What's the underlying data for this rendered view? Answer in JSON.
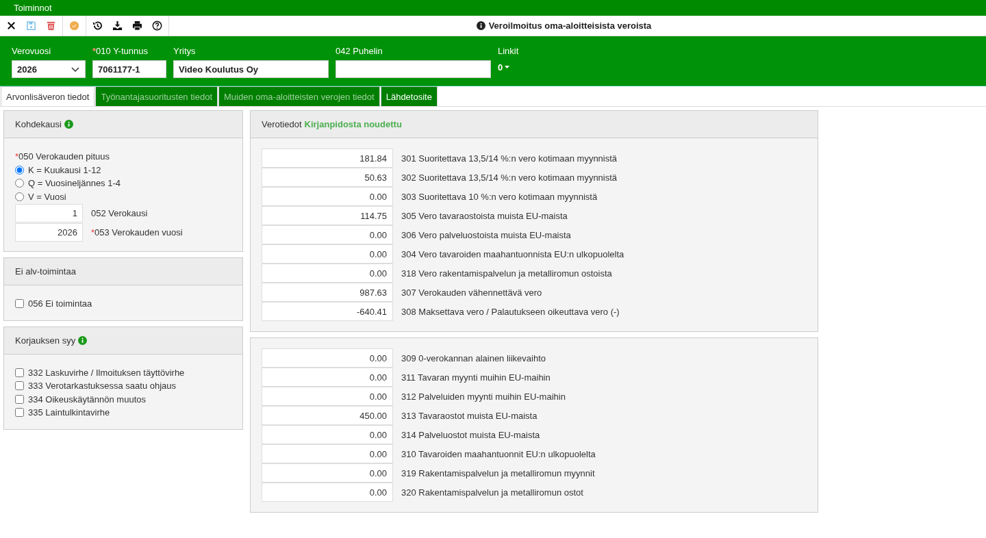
{
  "menu_bar": {
    "title": "Toiminnot"
  },
  "toolbar": {
    "title": "Veroilmoitus oma-aloitteisista veroista"
  },
  "header_fields": [
    {
      "kind": "select",
      "label": "Verovuosi",
      "value": "2026"
    },
    {
      "kind": "input",
      "label": "010 Y-tunnus",
      "required_mark": "*",
      "value": "7061177-1"
    },
    {
      "kind": "input",
      "label": "Yritys",
      "value": "Video Koulutus Oy",
      "wide": true
    },
    {
      "kind": "input",
      "label": "042 Puhelin",
      "wide": true
    },
    {
      "kind": "links",
      "label": "Linkit",
      "value": "0"
    }
  ],
  "tabs": [
    {
      "label": "Arvonlisäveron tiedot",
      "selected": true
    },
    {
      "label": "Työnantajasuoritusten tiedot",
      "selected": false
    },
    {
      "label": "Muiden oma-aloitteisten verojen tiedot",
      "selected": false
    },
    {
      "label": "Lähdetosite",
      "selected": false
    }
  ],
  "left_panels": [
    {
      "title": "Kohdekausi",
      "info": true,
      "items": [
        {
          "kind": "label",
          "text": "050 Verokauden pituus",
          "required_mark": "*"
        },
        {
          "kind": "radio",
          "text": "K = Kuukausi 1-12",
          "selected": true
        },
        {
          "kind": "radio",
          "text": "Q = Vuosineljännes 1-4",
          "selected": false
        },
        {
          "kind": "radio",
          "text": "V = Vuosi",
          "selected": false
        },
        {
          "kind": "field",
          "value": "1",
          "text": "052 Verokausi"
        },
        {
          "kind": "field",
          "value": "2026",
          "text": "053 Verokauden vuosi",
          "required_mark": "*"
        }
      ]
    },
    {
      "title": "Ei alv-toimintaa",
      "info": false,
      "items": [
        {
          "kind": "checkbox",
          "text": "056 Ei toimintaa",
          "checked": false
        }
      ]
    },
    {
      "title": "Korjauksen syy",
      "info": true,
      "items": [
        {
          "kind": "checkbox",
          "text": "332 Laskuvirhe / Ilmoituksen täyttövirhe",
          "checked": false
        },
        {
          "kind": "checkbox",
          "text": "333 Verotarkastuksessa saatu ohjaus",
          "checked": false
        },
        {
          "kind": "checkbox",
          "text": "334 Oikeuskäytännön muutos",
          "checked": false
        },
        {
          "kind": "checkbox",
          "text": "335 Laintulkintavirhe",
          "checked": false
        }
      ]
    }
  ],
  "tax_panels": [
    {
      "title": "Verotiedot",
      "status": "Kirjanpidosta noudettu",
      "rows": [
        {
          "value": "181.84",
          "label": "301 Suoritettava 13,5/14 %:n vero kotimaan myynnistä"
        },
        {
          "value": "50.63",
          "label": "302 Suoritettava 13,5/14 %:n vero kotimaan myynnistä"
        },
        {
          "value": "0.00",
          "label": "303 Suoritettava 10 %:n vero kotimaan myynnistä"
        },
        {
          "value": "114.75",
          "label": "305 Vero tavaraostoista muista EU-maista"
        },
        {
          "value": "0.00",
          "label": "306 Vero palveluostoista muista EU-maista"
        },
        {
          "value": "0.00",
          "label": "304 Vero tavaroiden maahantuonnista EU:n ulkopuolelta"
        },
        {
          "value": "0.00",
          "label": "318 Vero rakentamispalvelun ja metalliromun ostoista"
        },
        {
          "value": "987.63",
          "label": "307 Verokauden vähennettävä vero"
        },
        {
          "value": "-640.41",
          "label": "308 Maksettava vero / Palautukseen oikeuttava vero (-)"
        }
      ]
    },
    {
      "rows": [
        {
          "value": "0.00",
          "label": "309 0-verokannan alainen liikevaihto"
        },
        {
          "value": "0.00",
          "label": "311 Tavaran myynti muihin EU-maihin"
        },
        {
          "value": "0.00",
          "label": "312 Palveluiden myynti muihin EU-maihin"
        },
        {
          "value": "450.00",
          "label": "313 Tavaraostot muista EU-maista"
        },
        {
          "value": "0.00",
          "label": "314 Palveluostot muista EU-maista"
        },
        {
          "value": "0.00",
          "label": "310 Tavaroiden maahantuonnit EU:n ulkopuolelta"
        },
        {
          "value": "0.00",
          "label": "319 Rakentamispalvelun ja metalliromun myynnit"
        },
        {
          "value": "0.00",
          "label": "320 Rakentamispalvelun ja metalliromun ostot"
        }
      ]
    }
  ]
}
